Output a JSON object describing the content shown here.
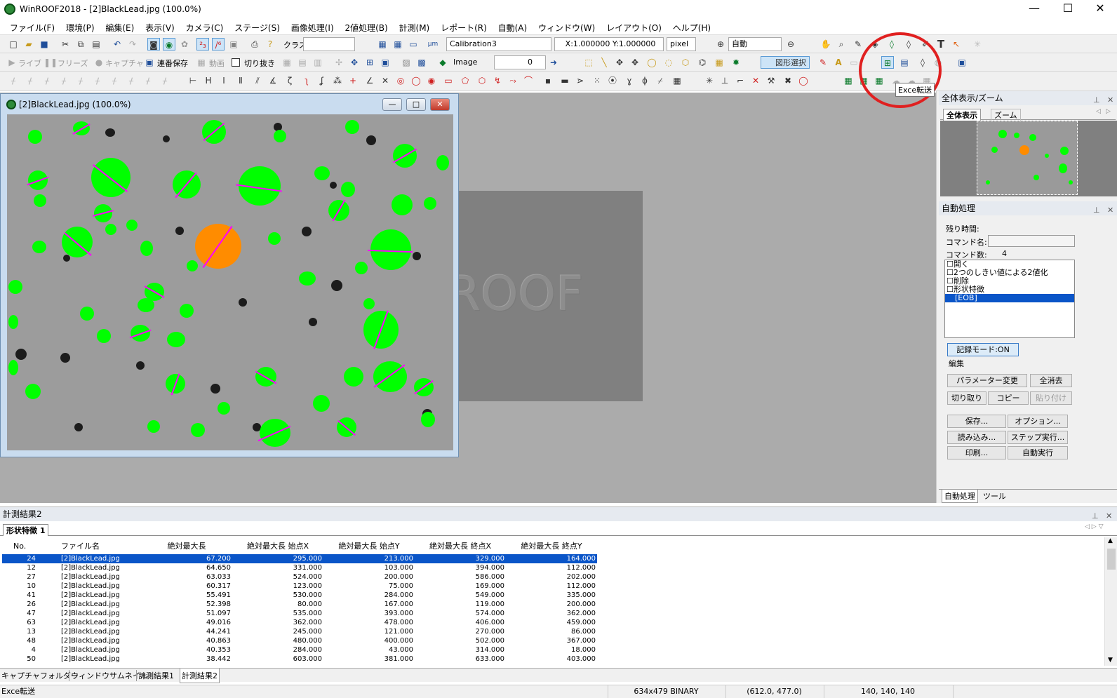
{
  "window": {
    "title": "WinROOF2018 - [2]BlackLead.jpg (100.0%)",
    "minimize": "—",
    "maximize": "☐",
    "close": "✕"
  },
  "menu": [
    "ファイル(F)",
    "環境(P)",
    "編集(E)",
    "表示(V)",
    "カメラ(C)",
    "ステージ(S)",
    "画像処理(I)",
    "2値処理(B)",
    "計測(M)",
    "レポート(R)",
    "自動(A)",
    "ウィンドウ(W)",
    "レイアウト(O)",
    "ヘルプ(H)"
  ],
  "toolbar1": {
    "class_label": "クラス",
    "calibration": "Calibration3",
    "scale": "X:1.000000 Y:1.000000",
    "unit": "pixel",
    "zoom": "自動"
  },
  "toolbar2": {
    "live": "ライブ",
    "freeze": "フリーズ",
    "capture": "キャプチャ",
    "serial_save": "連番保存",
    "video": "動画",
    "crop": "切り抜き",
    "image_label": "Image",
    "image_value": "0",
    "shape_select": "図形選択"
  },
  "tooltip": "Exce転送",
  "image_window": {
    "title": "[2]BlackLead.jpg (100.0%)",
    "min": "—",
    "restore": "□",
    "close": "✕"
  },
  "logo_text": "ROOF",
  "overview": {
    "title": "全体表示/ズーム",
    "tab_all": "全体表示",
    "tab_zoom": "ズーム"
  },
  "auto": {
    "title": "自動処理",
    "remaining": "残り時間:",
    "command_name": "コマンド名:",
    "command_count": "コマンド数:",
    "count_value": "4",
    "commands": [
      "開く",
      "2つのしきい値による2値化",
      "削除",
      "形状特徴"
    ],
    "eob": "[EOB]",
    "record_mode": "記録モード:ON",
    "edit": "編集",
    "param_change": "パラメーター変更",
    "clear_all": "全消去",
    "cut": "切り取り",
    "copy": "コピー",
    "paste": "貼り付け",
    "save": "保存...",
    "options": "オプション...",
    "load": "読み込み...",
    "step_run": "ステップ実行...",
    "print": "印刷...",
    "auto_run": "自動実行",
    "tab_auto": "自動処理",
    "tab_tool": "ツール"
  },
  "results": {
    "title": "計測結果2",
    "tab": "形状特徴 1",
    "columns": [
      "No.",
      "ファイル名",
      "絶対最大長",
      "絶対最大長 始点X",
      "絶対最大長 始点Y",
      "絶対最大長 終点X",
      "絶対最大長 終点Y"
    ],
    "rows": [
      [
        "24",
        "[2]BlackLead.jpg",
        "67.200",
        "295.000",
        "213.000",
        "329.000",
        "164.000"
      ],
      [
        "12",
        "[2]BlackLead.jpg",
        "64.650",
        "331.000",
        "103.000",
        "394.000",
        "112.000"
      ],
      [
        "27",
        "[2]BlackLead.jpg",
        "63.033",
        "524.000",
        "200.000",
        "586.000",
        "202.000"
      ],
      [
        "10",
        "[2]BlackLead.jpg",
        "60.317",
        "123.000",
        "75.000",
        "169.000",
        "112.000"
      ],
      [
        "41",
        "[2]BlackLead.jpg",
        "55.491",
        "530.000",
        "284.000",
        "549.000",
        "335.000"
      ],
      [
        "26",
        "[2]BlackLead.jpg",
        "52.398",
        "80.000",
        "167.000",
        "119.000",
        "200.000"
      ],
      [
        "47",
        "[2]BlackLead.jpg",
        "51.097",
        "535.000",
        "393.000",
        "574.000",
        "362.000"
      ],
      [
        "63",
        "[2]BlackLead.jpg",
        "49.016",
        "362.000",
        "478.000",
        "406.000",
        "459.000"
      ],
      [
        "13",
        "[2]BlackLead.jpg",
        "44.241",
        "245.000",
        "121.000",
        "270.000",
        "86.000"
      ],
      [
        "48",
        "[2]BlackLead.jpg",
        "40.863",
        "480.000",
        "400.000",
        "502.000",
        "367.000"
      ],
      [
        "4",
        "[2]BlackLead.jpg",
        "40.353",
        "284.000",
        "43.000",
        "314.000",
        "18.000"
      ],
      [
        "50",
        "[2]BlackLead.jpg",
        "38.442",
        "603.000",
        "381.000",
        "633.000",
        "403.000"
      ]
    ]
  },
  "bottom_tabs": [
    "キャプチャフォルダー",
    "ウィンドウサムネイル",
    "計測結果1",
    "計測結果2"
  ],
  "status": {
    "message": "Exce転送",
    "image_info": "634x479 BINARY",
    "coords": "(612.0, 477.0)",
    "rgb": "140, 140, 140"
  },
  "colors": {
    "selection": "#0a55c8",
    "particle": "#00ff00",
    "selected_particle": "#ff8c00",
    "max_length_line": "#ff00ff",
    "annotation": "#e02020"
  }
}
